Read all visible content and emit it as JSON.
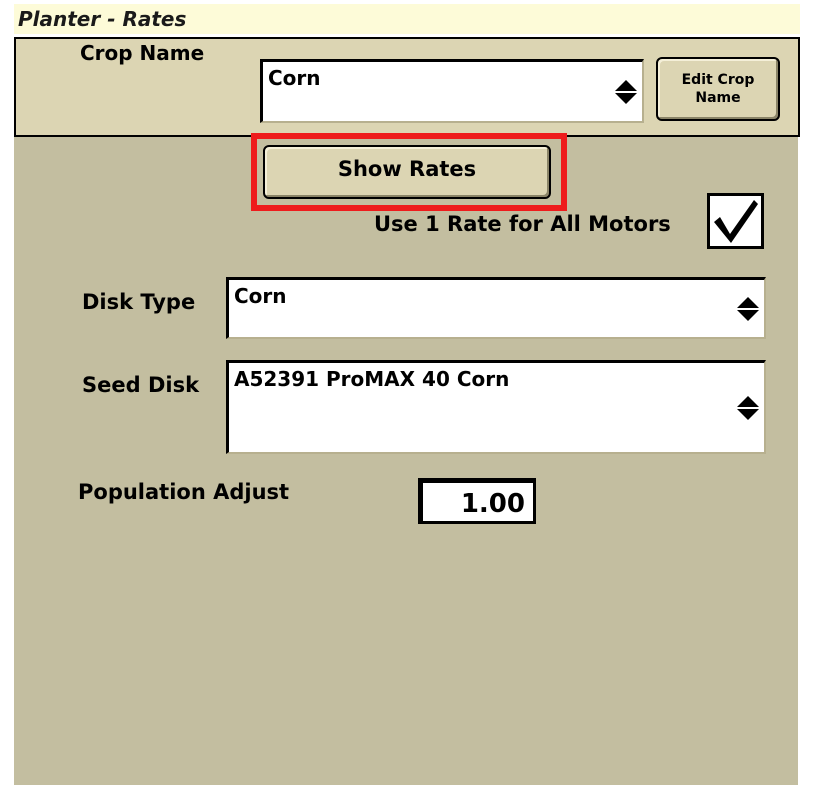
{
  "window": {
    "title": "Planter - Rates"
  },
  "crop": {
    "label": "Crop Name",
    "value": "Corn",
    "edit_button_line1": "Edit Crop",
    "edit_button_line2": "Name"
  },
  "show_rates_label": "Show Rates",
  "use_one_rate": {
    "label": "Use 1 Rate for All Motors",
    "checked": true
  },
  "disk_type": {
    "label": "Disk Type",
    "value": "Corn"
  },
  "seed_disk": {
    "label": "Seed Disk",
    "value": "A52391 ProMAX 40 Corn"
  },
  "population_adjust": {
    "label": "Population Adjust",
    "value": "1.00"
  },
  "colors": {
    "highlight": "#ee1c1c",
    "panel": "#c3bea0",
    "button": "#dcd5b3"
  }
}
